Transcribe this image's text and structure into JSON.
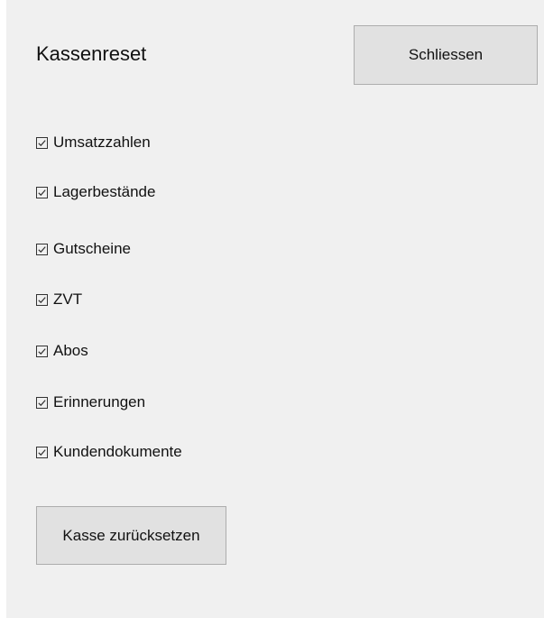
{
  "dialog": {
    "title": "Kassenreset",
    "close_label": "Schliessen",
    "reset_label": "Kasse zurücksetzen"
  },
  "options": [
    {
      "label": "Umsatzzahlen",
      "checked": true
    },
    {
      "label": "Lagerbestände",
      "checked": true
    },
    {
      "label": "Gutscheine",
      "checked": true
    },
    {
      "label": "ZVT",
      "checked": true
    },
    {
      "label": "Abos",
      "checked": true
    },
    {
      "label": "Erinnerungen",
      "checked": true
    },
    {
      "label": "Kundendokumente",
      "checked": true
    }
  ],
  "colors": {
    "background": "#f0f0f0",
    "button_face": "#e1e1e1",
    "button_border": "#adadad",
    "text": "#111111"
  }
}
